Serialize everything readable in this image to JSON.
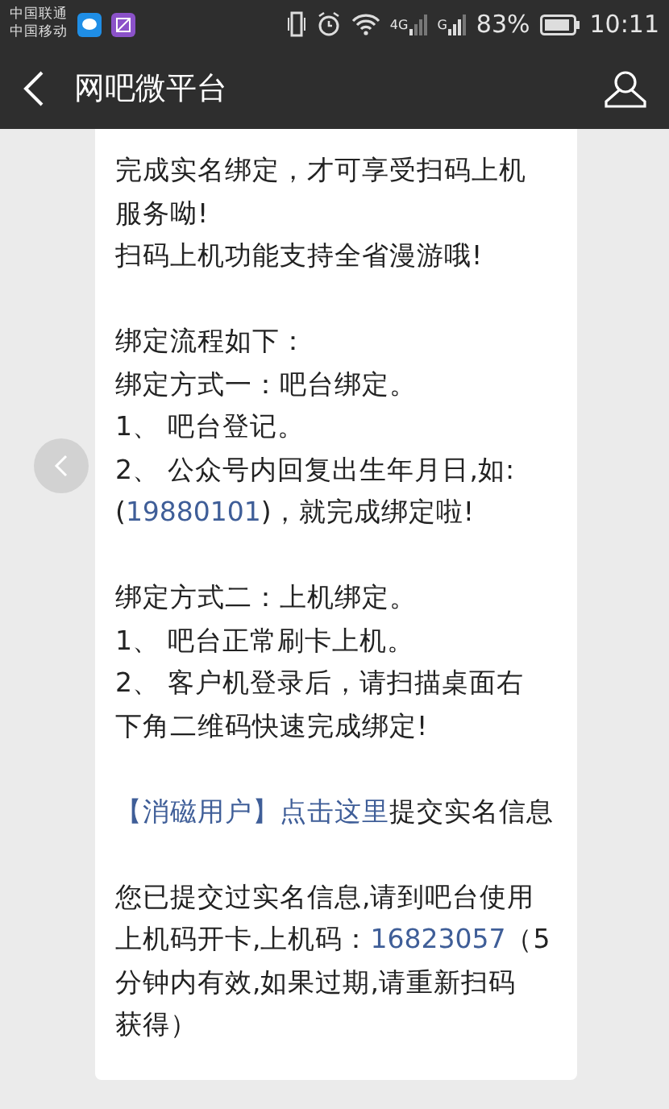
{
  "status_bar": {
    "carriers": [
      "中国联通",
      "中国移动"
    ],
    "network_1": "4G",
    "network_2": "G",
    "battery": "83%",
    "time": "10:11"
  },
  "header": {
    "title": "网吧微平台"
  },
  "message": {
    "paragraphs": [
      {
        "lines": [
          [
            {
              "text": "完成实名绑定，才可享受扫码上机",
              "link": false
            }
          ],
          [
            {
              "text": "服务呦!",
              "link": false
            }
          ],
          [
            {
              "text": "扫码上机功能支持全省漫游哦!",
              "link": false
            }
          ]
        ]
      },
      {
        "lines": [
          [
            {
              "text": "绑定流程如下：",
              "link": false
            }
          ],
          [
            {
              "text": "绑定方式一：吧台绑定。",
              "link": false
            }
          ],
          [
            {
              "text": "1、 吧台登记。",
              "link": false
            }
          ],
          [
            {
              "text": "2、 公众号内回复出生年月日,如:",
              "link": false
            }
          ],
          [
            {
              "text": "(",
              "link": false
            },
            {
              "text": "19880101",
              "link": true
            },
            {
              "text": ")，就完成绑定啦!",
              "link": false
            }
          ]
        ]
      },
      {
        "lines": [
          [
            {
              "text": "绑定方式二：上机绑定。",
              "link": false
            }
          ],
          [
            {
              "text": "1、 吧台正常刷卡上机。",
              "link": false
            }
          ],
          [
            {
              "text": "2、 客户机登录后，请扫描桌面右",
              "link": false
            }
          ],
          [
            {
              "text": "下角二维码快速完成绑定!",
              "link": false
            }
          ]
        ]
      },
      {
        "lines": [
          [
            {
              "text": "【消磁用户】点击这里",
              "link": true
            },
            {
              "text": "提交实名信息",
              "link": false
            }
          ]
        ]
      },
      {
        "lines": [
          [
            {
              "text": "您已提交过实名信息,请到吧台使用",
              "link": false
            }
          ],
          [
            {
              "text": "上机码开卡,上机码：",
              "link": false
            },
            {
              "text": "16823057",
              "link": true
            },
            {
              "text": "（5",
              "link": false
            }
          ],
          [
            {
              "text": "分钟内有效,如果过期,请重新扫码",
              "link": false
            }
          ],
          [
            {
              "text": "获得）",
              "link": false
            }
          ]
        ]
      }
    ]
  }
}
